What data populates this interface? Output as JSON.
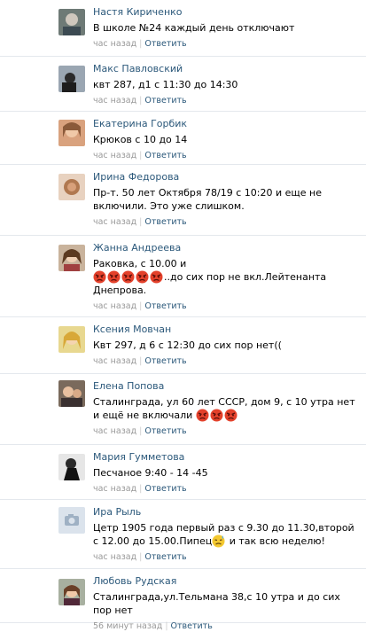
{
  "reply_label": "Ответить",
  "separator": "|",
  "colors": {
    "author_link": "#2b587a",
    "meta_gray": "#999999",
    "divider": "#e4e8ed",
    "emoji_red": "#e3412b"
  },
  "comments": [
    {
      "author": "Настя Кириченко",
      "text_parts": [
        "В школе №24 каждый день отключают"
      ],
      "emoji_count": 0,
      "time": "час назад",
      "avatar_icon": "user-photo"
    },
    {
      "author": "Макс Павловский",
      "text_parts": [
        "квт 287, д1 с 11:30 до 14:30"
      ],
      "emoji_count": 0,
      "time": "час назад",
      "avatar_icon": "user-photo"
    },
    {
      "author": "Екатерина Горбик",
      "text_parts": [
        "Крюков с 10 до 14"
      ],
      "emoji_count": 0,
      "time": "час назад",
      "avatar_icon": "user-photo"
    },
    {
      "author": "Ирина Федорова",
      "text_parts": [
        "Пр-т. 50 лет Октября 78/19 с 10:20 и еще не включили. Это уже слишком."
      ],
      "emoji_count": 0,
      "time": "час назад",
      "avatar_icon": "user-photo"
    },
    {
      "author": "Жанна Андреева",
      "text_parts": [
        "Раковка, с 10.00 и",
        "..до сих пор не вкл.Лейтенанта Днепрова."
      ],
      "emoji_count": 5,
      "time": "час назад",
      "avatar_icon": "user-photo"
    },
    {
      "author": "Ксения Мовчан",
      "text_parts": [
        "Квт 297, д 6 с 12:30 до сих пор нет(("
      ],
      "emoji_count": 0,
      "time": "час назад",
      "avatar_icon": "user-photo"
    },
    {
      "author": "Елена Попова",
      "text_parts": [
        "Сталинграда, ул 60 лет СССР, дом 9, с 10 утра нет и ещё не включали",
        ""
      ],
      "emoji_count": 3,
      "time": "час назад",
      "avatar_icon": "user-photo"
    },
    {
      "author": "Мария Гумметова",
      "text_parts": [
        "Песчаное 9:40 - 14 -45"
      ],
      "emoji_count": 0,
      "time": "час назад",
      "avatar_icon": "user-photo"
    },
    {
      "author": "Ира Рыль",
      "text_parts": [
        "Цетр 1905 года первый раз с 9.30 до 11.30,второй с 12.00 до 15.00.Пипец",
        " и так всю неделю!"
      ],
      "emoji_count": 1,
      "emoji_kind": "sweat",
      "time": "час назад",
      "avatar_icon": "camera-icon"
    },
    {
      "author": "Любовь Рудская",
      "text_parts": [
        "Сталинграда,ул.Тельмана 38,с 10 утра и до сих пор нет"
      ],
      "emoji_count": 0,
      "time": "56 минут назад",
      "avatar_icon": "user-photo"
    }
  ]
}
